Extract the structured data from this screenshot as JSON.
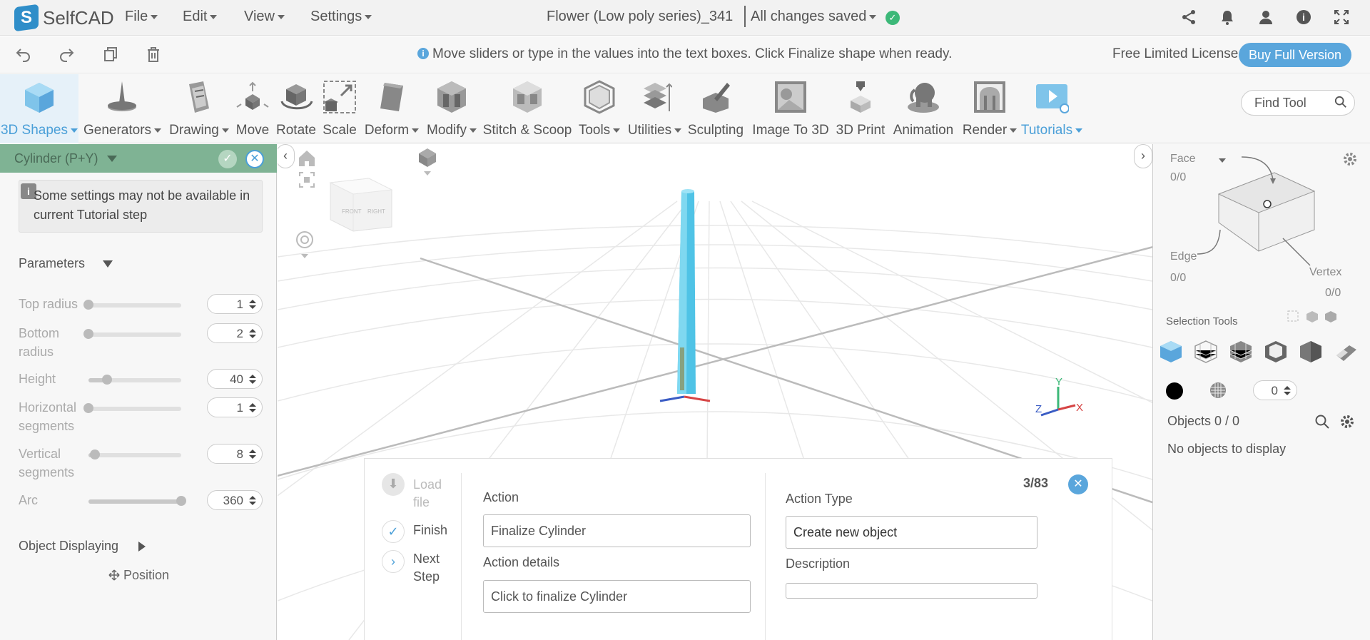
{
  "app": {
    "brand": "SelfCAD",
    "menus": [
      "File",
      "Edit",
      "View",
      "Settings"
    ],
    "document_title": "Flower (Low poly series)_341",
    "save_status": "All changes saved"
  },
  "infobar": {
    "message": "Move sliders or type in the values into the text boxes. Click Finalize shape when ready.",
    "license": "Free Limited License",
    "buy_label": "Buy Full Version"
  },
  "ribbon": {
    "tools": [
      {
        "label": "3D Shapes",
        "dropdown": true,
        "icon": "cube-icon"
      },
      {
        "label": "Generators",
        "dropdown": true,
        "icon": "generators-icon"
      },
      {
        "label": "Drawing",
        "dropdown": true,
        "icon": "drawing-icon"
      },
      {
        "label": "Move",
        "dropdown": false,
        "icon": "move-icon"
      },
      {
        "label": "Rotate",
        "dropdown": false,
        "icon": "rotate-icon"
      },
      {
        "label": "Scale",
        "dropdown": false,
        "icon": "scale-icon"
      },
      {
        "label": "Deform",
        "dropdown": true,
        "icon": "deform-icon"
      },
      {
        "label": "Modify",
        "dropdown": true,
        "icon": "modify-icon"
      },
      {
        "label": "Stitch & Scoop",
        "dropdown": false,
        "icon": "stitch-scoop-icon"
      },
      {
        "label": "Tools",
        "dropdown": true,
        "icon": "tools-icon"
      },
      {
        "label": "Utilities",
        "dropdown": true,
        "icon": "utilities-icon"
      },
      {
        "label": "Sculpting",
        "dropdown": false,
        "icon": "sculpting-icon"
      },
      {
        "label": "Image To 3D",
        "dropdown": false,
        "icon": "image-to-3d-icon"
      },
      {
        "label": "3D Print",
        "dropdown": false,
        "icon": "3d-print-icon"
      },
      {
        "label": "Animation",
        "dropdown": false,
        "icon": "animation-icon"
      },
      {
        "label": "Render",
        "dropdown": true,
        "icon": "render-icon"
      },
      {
        "label": "Tutorials",
        "dropdown": true,
        "icon": "tutorials-icon"
      }
    ],
    "find_placeholder": "Find Tool"
  },
  "left_panel": {
    "title": "Cylinder (P+Y)",
    "notice": "Some settings may not be available in current Tutorial step",
    "parameters_label": "Parameters",
    "params": [
      {
        "label": "Top radius",
        "value": "1",
        "level": 0.0
      },
      {
        "label": "Bottom radius",
        "value": "2",
        "level": 0.0
      },
      {
        "label": "Height",
        "value": "40",
        "level": 0.2
      },
      {
        "label": "Horizontal segments",
        "value": "1",
        "level": 0.0
      },
      {
        "label": "Vertical segments",
        "value": "8",
        "level": 0.07
      },
      {
        "label": "Arc",
        "value": "360",
        "level": 1.0
      }
    ],
    "object_displaying_label": "Object Displaying",
    "position_label": "Position"
  },
  "viewport": {
    "axis_labels": {
      "x": "X",
      "y": "Y",
      "z": "Z"
    },
    "view_cube_labels": [
      "FRONT",
      "RIGHT"
    ]
  },
  "tutorial": {
    "steps": [
      {
        "label": "Load file",
        "state": "disabled"
      },
      {
        "label": "Finish",
        "state": "done"
      },
      {
        "label": "Next Step",
        "state": "next"
      }
    ],
    "counter": "3/83",
    "action_label": "Action",
    "action_value": "Finalize Cylinder",
    "action_details_label": "Action details",
    "action_details_value": "Click to finalize Cylinder",
    "action_type_label": "Action Type",
    "action_type_value": "Create new object",
    "description_label": "Description",
    "description_value": ""
  },
  "right_panel": {
    "face_label": "Face",
    "face_count": "0/0",
    "edge_label": "Edge",
    "edge_count": "0/0",
    "vertex_label": "Vertex",
    "vertex_count": "0/0",
    "selection_tools_label": "Selection Tools",
    "brush_value": "0",
    "objects_label": "Objects 0 / 0",
    "no_objects": "No objects to display"
  },
  "colors": {
    "accent": "#5aa6dc",
    "panel_header": "#7fb394",
    "saved_check": "#3cb878",
    "cylinder": "#4fc3e6"
  }
}
